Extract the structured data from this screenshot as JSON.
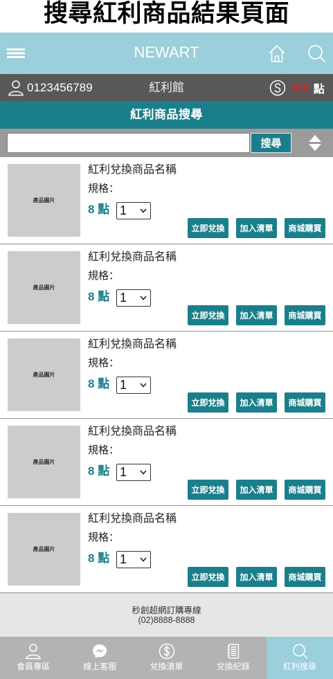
{
  "page_title": "搜尋紅利商品結果頁面",
  "colors": {
    "header_bg": "#9bcfdb",
    "accent_teal": "#1b7f8b",
    "member_bar_bg": "#585858",
    "search_bar_bg": "#9b9b9b",
    "points_red": "#e8231f",
    "thumb_bg": "#cccccc",
    "footer_bg": "#e6e6e6",
    "nav_bg": "#b3b3b3",
    "nav_active_bg": "#9bcfdb"
  },
  "header": {
    "menu_icon": "hamburger-icon",
    "brand": "NEWART",
    "home_icon": "home-icon",
    "search_icon": "search-icon"
  },
  "member_bar": {
    "user_icon": "user-icon",
    "account": "0123456789",
    "section": "紅利館",
    "points_icon": "coin-icon",
    "points_value": "888",
    "points_unit": "點"
  },
  "section_title": "紅利商品搜尋",
  "search": {
    "value": "",
    "button_label": "搜尋",
    "sort_icon": "sort-icon"
  },
  "products": [
    {
      "image_label": "產品圖片",
      "name": "紅利兌換商品名稱",
      "spec_label": "規格：",
      "points": "8",
      "points_unit": "點",
      "quantity": "1",
      "actions": [
        "立即兌換",
        "加入清單",
        "商城購買"
      ]
    },
    {
      "image_label": "產品圖片",
      "name": "紅利兌換商品名稱",
      "spec_label": "規格：",
      "points": "8",
      "points_unit": "點",
      "quantity": "1",
      "actions": [
        "立即兌換",
        "加入清單",
        "商城購買"
      ]
    },
    {
      "image_label": "產品圖片",
      "name": "紅利兌換商品名稱",
      "spec_label": "規格：",
      "points": "8",
      "points_unit": "點",
      "quantity": "1",
      "actions": [
        "立即兌換",
        "加入清單",
        "商城購買"
      ]
    },
    {
      "image_label": "產品圖片",
      "name": "紅利兌換商品名稱",
      "spec_label": "規格：",
      "points": "8",
      "points_unit": "點",
      "quantity": "1",
      "actions": [
        "立即兌換",
        "加入清單",
        "商城購買"
      ]
    },
    {
      "image_label": "產品圖片",
      "name": "紅利兌換商品名稱",
      "spec_label": "規格：",
      "points": "8",
      "points_unit": "點",
      "quantity": "1",
      "actions": [
        "立即兌換",
        "加入清單",
        "商城購買"
      ]
    }
  ],
  "footer": {
    "hotline_label": "秒創超網訂購專線",
    "phone": "(02)8888-8888"
  },
  "bottom_nav": {
    "items": [
      {
        "label": "會員專區",
        "icon": "user-icon",
        "active": false
      },
      {
        "label": "線上客服",
        "icon": "messenger-icon",
        "active": false
      },
      {
        "label": "兌換清單",
        "icon": "dollar-coin-icon",
        "active": false
      },
      {
        "label": "兌換紀錄",
        "icon": "record-list-icon",
        "active": false
      },
      {
        "label": "紅利搜尋",
        "icon": "search-icon",
        "active": true
      }
    ]
  }
}
